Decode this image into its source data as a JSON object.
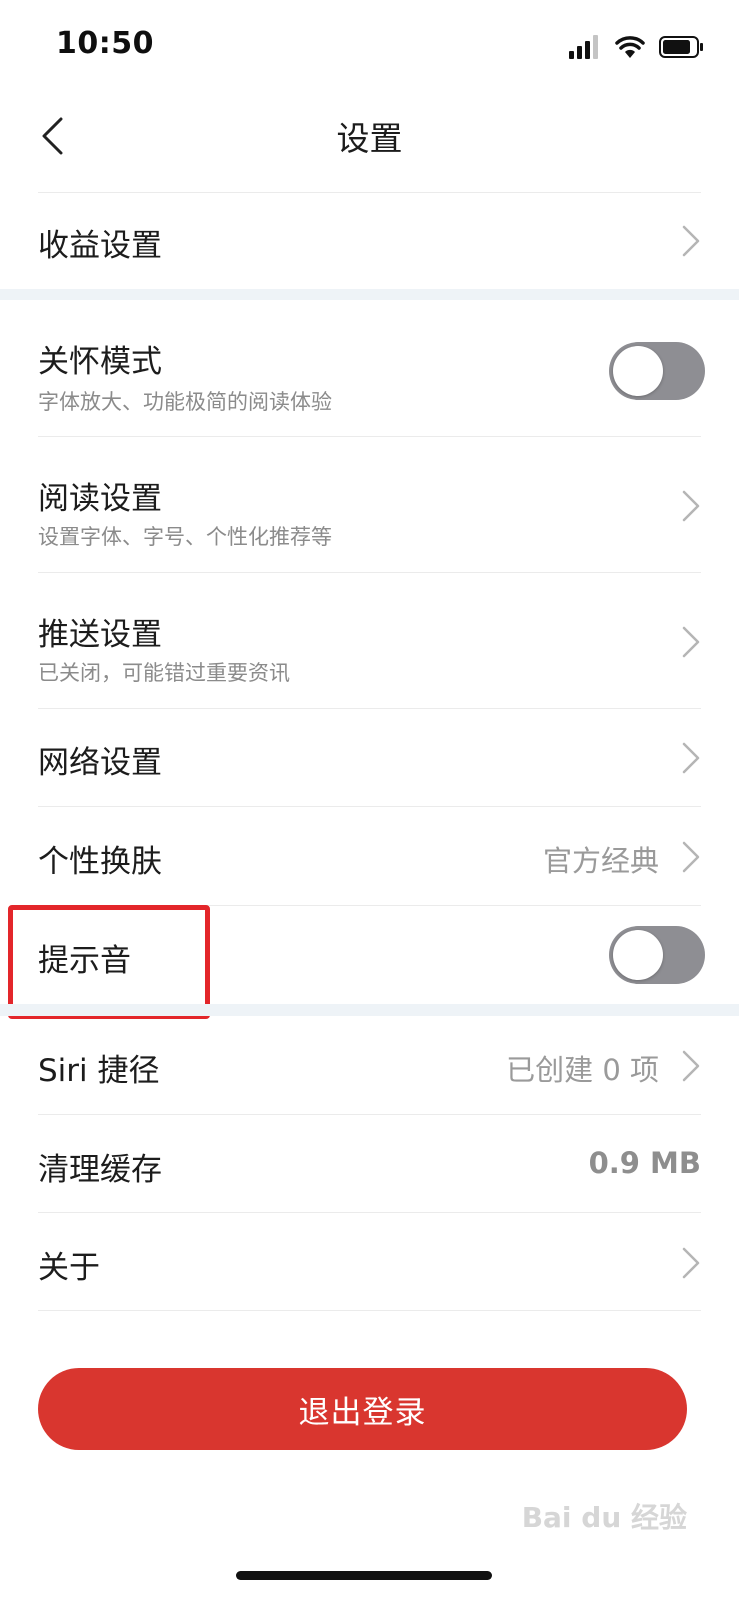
{
  "status_bar": {
    "time": "10:50",
    "icons": [
      "signal-icon",
      "wifi-icon",
      "battery-icon"
    ]
  },
  "nav": {
    "title": "设置",
    "back_icon": "chevron-left-icon"
  },
  "rows": {
    "earnings": {
      "title": "收益设置"
    },
    "care_mode": {
      "title": "关怀模式",
      "subtitle": "字体放大、功能极简的阅读体验",
      "enabled": false
    },
    "reading": {
      "title": "阅读设置",
      "subtitle": "设置字体、字号、个性化推荐等"
    },
    "push": {
      "title": "推送设置",
      "subtitle": "已关闭，可能错过重要资讯"
    },
    "network": {
      "title": "网络设置"
    },
    "skin": {
      "title": "个性换肤",
      "value": "官方经典"
    },
    "sound": {
      "title": "提示音",
      "enabled": false
    },
    "siri": {
      "title": "Siri 捷径",
      "value": "已创建 0 项"
    },
    "cache": {
      "title": "清理缓存",
      "value": "0.9 MB"
    },
    "about": {
      "title": "关于"
    }
  },
  "logout": {
    "label": "退出登录"
  },
  "watermark": {
    "text": "Bai du 经验"
  },
  "colors": {
    "accent_red": "#d9362f",
    "highlight_red": "#e3262a",
    "toggle_off": "#8e8e93",
    "section_band": "#eef3f7"
  }
}
